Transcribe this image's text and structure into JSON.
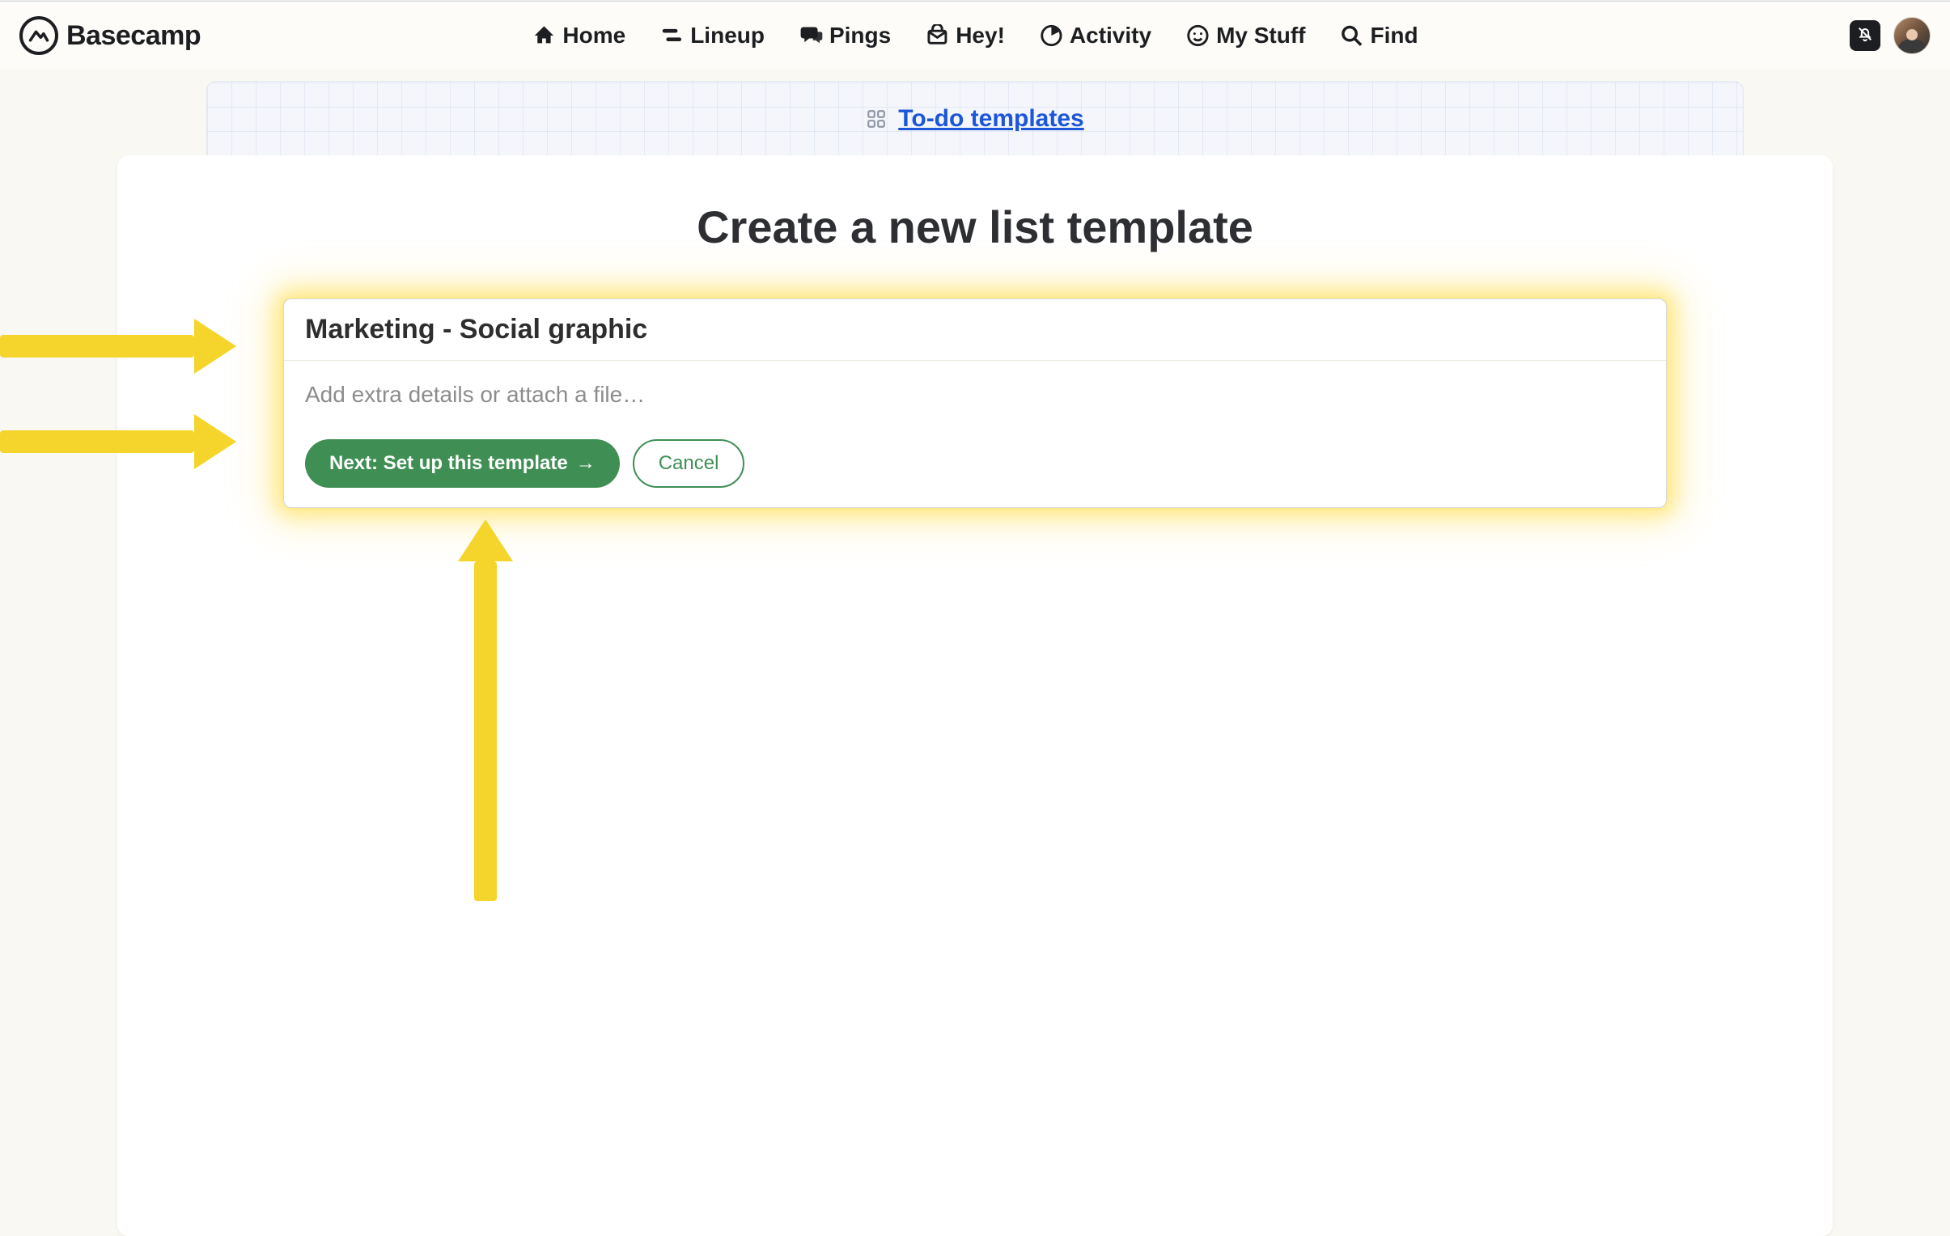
{
  "brand": {
    "name": "Basecamp"
  },
  "nav": {
    "items": [
      {
        "label": "Home"
      },
      {
        "label": "Lineup"
      },
      {
        "label": "Pings"
      },
      {
        "label": "Hey!"
      },
      {
        "label": "Activity"
      },
      {
        "label": "My Stuff"
      },
      {
        "label": "Find"
      }
    ]
  },
  "breadcrumb": {
    "label": "To-do templates"
  },
  "page": {
    "title": "Create a new list template",
    "template_name_value": "Marketing - Social graphic",
    "details_placeholder": "Add extra details or attach a file…",
    "primary_button": "Next: Set up this template",
    "primary_button_arrow": "→",
    "cancel_button": "Cancel"
  }
}
